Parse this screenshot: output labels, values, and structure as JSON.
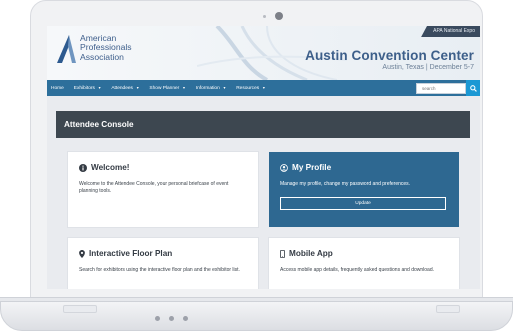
{
  "site": {
    "logo_lines": [
      "American",
      "Professionals",
      "Association"
    ],
    "badge": "APA National Expo",
    "venue_title": "Austin Convention Center",
    "venue_sub": "Austin, Texas  |  December 5-7"
  },
  "nav": {
    "items": [
      {
        "label": "Home",
        "has_menu": false
      },
      {
        "label": "Exhibitors",
        "has_menu": true
      },
      {
        "label": "Attendees",
        "has_menu": true
      },
      {
        "label": "Show Planner",
        "has_menu": true
      },
      {
        "label": "Information",
        "has_menu": true
      },
      {
        "label": "Resources",
        "has_menu": true
      }
    ],
    "search_placeholder": "search",
    "search_icon": "magnifier-icon"
  },
  "console": {
    "title": "Attendee Console"
  },
  "cards": {
    "welcome": {
      "icon": "info-circle-icon",
      "title": "Welcome!",
      "text": "Welcome to the Attendee Console, your personal briefcase of event planning tools."
    },
    "profile": {
      "icon": "user-circle-icon",
      "title": "My Profile",
      "text": "Manage my profile, change my password and preferences.",
      "button": "Update"
    },
    "floorplan": {
      "icon": "map-marker-icon",
      "title": "Interactive Floor Plan",
      "text": "Search for exhibitors using the interactive floor plan and the exhibitor list."
    },
    "mobile": {
      "icon": "mobile-phone-icon",
      "title": "Mobile App",
      "text": "Access mobile app details, frequently asked questions and download."
    }
  },
  "colors": {
    "nav_bar": "#2d6f9b",
    "search_button": "#1b98d4",
    "console_bar": "#3d4750",
    "profile_card": "#2e6891",
    "brand_text": "#3d5f8a"
  }
}
